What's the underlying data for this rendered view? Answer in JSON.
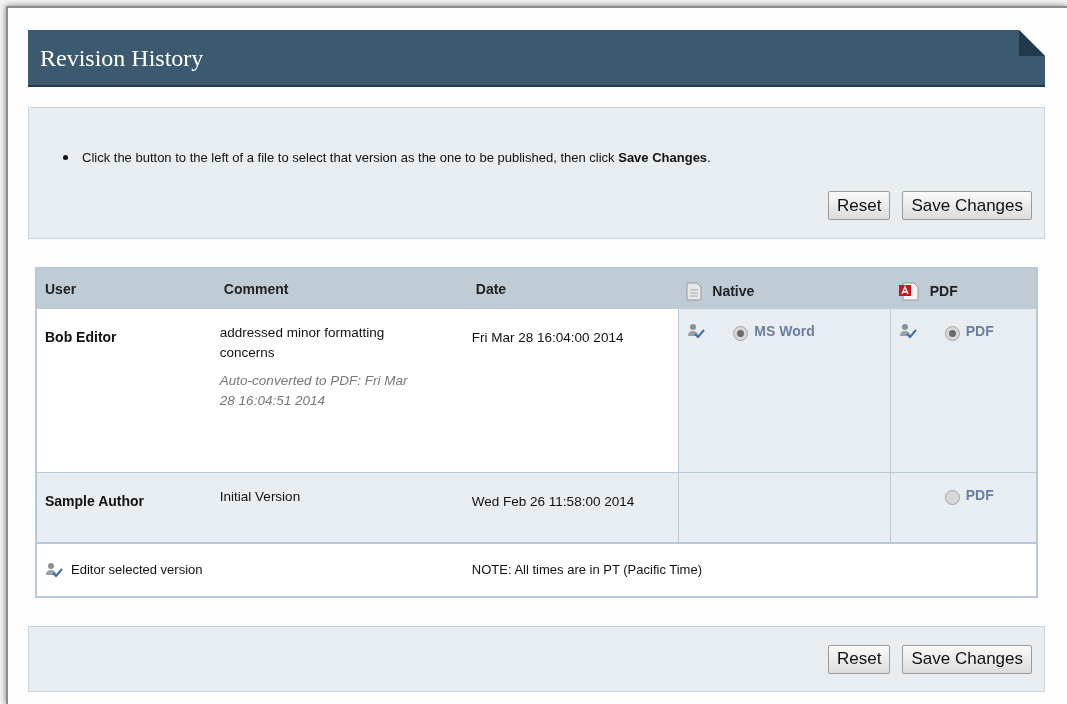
{
  "title": "Revision History",
  "instructions": [
    "Click the button to the left of a file to select that version as the one to be published, then click **Save Changes**."
  ],
  "buttons": [
    "Reset",
    "Save Changes"
  ],
  "table": {
    "columns": [
      {
        "label": "User",
        "kind": "text"
      },
      {
        "label": "Comment",
        "kind": "text"
      },
      {
        "label": "Date",
        "kind": "text"
      },
      {
        "label": "Native",
        "kind": "doc"
      },
      {
        "label": "PDF",
        "kind": "pdf"
      }
    ],
    "rows": [
      {
        "user": "Bob Editor",
        "comment": "addressed minor formatting concerns",
        "note": "Auto-converted to PDF: Fri Mar 28 16:04:51 2014",
        "date": "Fri Mar 28 16:04:00 2014",
        "native": {
          "label": "MS Word",
          "editor_selected": true,
          "selected": true
        },
        "pdf": {
          "label": "PDF",
          "editor_selected": true,
          "selected": true
        }
      },
      {
        "user": "Sample Author",
        "comment": "Initial Version",
        "date": "Wed Feb 26 11:58:00 2014",
        "pdf": {
          "label": "PDF",
          "editor_selected": false,
          "selected": false
        }
      }
    ],
    "legend": "Editor selected version",
    "note": "NOTE: All times are in PT (Pacific Time)"
  },
  "bottom_buttons": [
    "Reset",
    "Save Changes"
  ]
}
